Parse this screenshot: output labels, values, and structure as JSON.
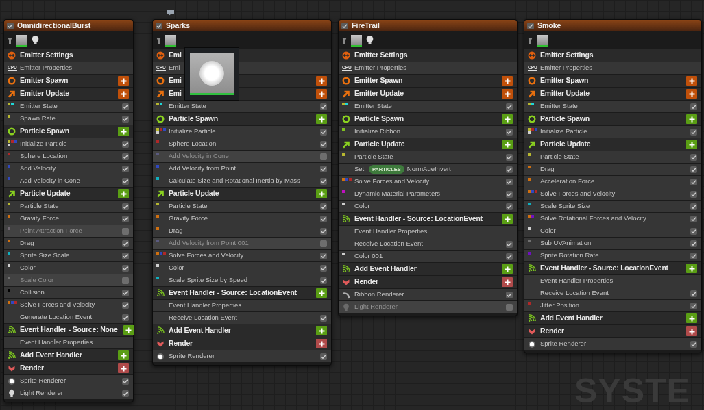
{
  "emitters": [
    {
      "name": "OmnidirectionalBurst",
      "enabled": true,
      "has_light": true,
      "preview_open": false,
      "items": [
        {
          "kind": "settings",
          "label": "Emitter Settings"
        },
        {
          "kind": "properties",
          "badge": "CPU",
          "label": "Emitter Properties"
        },
        {
          "kind": "emitter_spawn",
          "label": "Emitter Spawn"
        },
        {
          "kind": "emitter_update",
          "label": "Emitter Update"
        },
        {
          "kind": "module",
          "label": "Emitter State",
          "enabled": true,
          "dots": [
            {
              "color": "#b8b830"
            },
            {
              "color": "#20d8d8"
            }
          ]
        },
        {
          "kind": "module",
          "label": "Spawn Rate",
          "enabled": true,
          "dots": [
            {
              "color": "#b8b830"
            }
          ]
        },
        {
          "kind": "particle_spawn",
          "label": "Particle Spawn"
        },
        {
          "kind": "module",
          "label": "Initialize Particle",
          "enabled": true,
          "dots": [
            {
              "color": "#b8b830"
            },
            {
              "color": "#b02828"
            },
            {
              "color": "#3048c0"
            },
            {
              "color": "#d0d0d0"
            }
          ]
        },
        {
          "kind": "module",
          "label": "Sphere Location",
          "enabled": true,
          "dots": [
            {
              "color": "#b02828"
            }
          ]
        },
        {
          "kind": "module",
          "label": "Add Velocity",
          "enabled": true,
          "dots": [
            {
              "color": "#3048c0"
            }
          ]
        },
        {
          "kind": "module",
          "label": "Add Velocity in Cone",
          "enabled": true,
          "dots": [
            {
              "color": "#3048c0"
            }
          ]
        },
        {
          "kind": "particle_update",
          "label": "Particle Update"
        },
        {
          "kind": "module",
          "label": "Particle State",
          "enabled": true,
          "dots": [
            {
              "color": "#b8b830"
            }
          ]
        },
        {
          "kind": "module",
          "label": "Gravity Force",
          "enabled": true,
          "dots": [
            {
              "color": "#d07010"
            }
          ]
        },
        {
          "kind": "module",
          "label": "Point Attraction Force",
          "enabled": false,
          "dots": [
            {
              "color": "#6e6670"
            }
          ]
        },
        {
          "kind": "module",
          "label": "Drag",
          "enabled": true,
          "dots": [
            {
              "color": "#d07010"
            }
          ]
        },
        {
          "kind": "module",
          "label": "Sprite Size Scale",
          "enabled": true,
          "dots": [
            {
              "color": "#10b0c0"
            }
          ]
        },
        {
          "kind": "module",
          "label": "Color",
          "enabled": true,
          "dots": [
            {
              "color": "#d0d0d0"
            }
          ]
        },
        {
          "kind": "module",
          "label": "Scale Color",
          "enabled": false,
          "dots": [
            {
              "color": "#707070"
            }
          ]
        },
        {
          "kind": "module",
          "label": "Collision",
          "enabled": true,
          "dots": [
            {
              "color": "#000000"
            }
          ]
        },
        {
          "kind": "module",
          "label": "Solve Forces and Velocity",
          "enabled": true,
          "dots": [
            {
              "color": "#d07010"
            },
            {
              "color": "#3048c0"
            },
            {
              "color": "#b02828"
            }
          ]
        },
        {
          "kind": "module",
          "label": "Generate Location Event",
          "enabled": true
        },
        {
          "kind": "event_handler",
          "label": "Event Handler - Source: None"
        },
        {
          "kind": "property",
          "label": "Event Handler Properties"
        },
        {
          "kind": "add_event_handler",
          "label": "Add Event Handler"
        },
        {
          "kind": "render",
          "label": "Render"
        },
        {
          "kind": "sprite_renderer",
          "label": "Sprite Renderer",
          "enabled": true
        },
        {
          "kind": "light_renderer",
          "label": "Light Renderer",
          "enabled": true
        }
      ]
    },
    {
      "name": "Sparks",
      "enabled": true,
      "has_light": false,
      "preview_open": true,
      "items": [
        {
          "kind": "settings",
          "label": "Emi"
        },
        {
          "kind": "properties",
          "badge": "CPU",
          "label": "Emi"
        },
        {
          "kind": "emitter_spawn",
          "label": "Emi"
        },
        {
          "kind": "emitter_update",
          "label": "Emi"
        },
        {
          "kind": "module",
          "label": "Emitter State",
          "enabled": true,
          "dots": [
            {
              "color": "#b8b830"
            },
            {
              "color": "#20d8d8"
            }
          ]
        },
        {
          "kind": "particle_spawn",
          "label": "Particle Spawn"
        },
        {
          "kind": "module",
          "label": "Initialize Particle",
          "enabled": true,
          "dots": [
            {
              "color": "#b8b830"
            },
            {
              "color": "#b02828"
            },
            {
              "color": "#3048c0"
            },
            {
              "color": "#d0d0d0"
            }
          ]
        },
        {
          "kind": "module",
          "label": "Sphere Location",
          "enabled": true,
          "dots": [
            {
              "color": "#b02828"
            }
          ]
        },
        {
          "kind": "module",
          "label": "Add Velocity in Cone",
          "enabled": false,
          "dots": [
            {
              "color": "#5a5a80"
            }
          ]
        },
        {
          "kind": "module",
          "label": "Add Velocity from Point",
          "enabled": true,
          "dots": [
            {
              "color": "#3048c0"
            }
          ]
        },
        {
          "kind": "module",
          "label": "Calculate Size and Rotational Inertia by Mass",
          "enabled": true,
          "dots": [
            {
              "color": "#10b0c0"
            }
          ]
        },
        {
          "kind": "particle_update",
          "label": "Particle Update"
        },
        {
          "kind": "module",
          "label": "Particle State",
          "enabled": true,
          "dots": [
            {
              "color": "#b8b830"
            }
          ]
        },
        {
          "kind": "module",
          "label": "Gravity Force",
          "enabled": true,
          "dots": [
            {
              "color": "#d07010"
            }
          ]
        },
        {
          "kind": "module",
          "label": "Drag",
          "enabled": true,
          "dots": [
            {
              "color": "#d07010"
            }
          ]
        },
        {
          "kind": "module",
          "label": "Add Velocity from Point 001",
          "enabled": false,
          "dots": [
            {
              "color": "#5a5a80"
            }
          ]
        },
        {
          "kind": "module",
          "label": "Solve Forces and Velocity",
          "enabled": true,
          "dots": [
            {
              "color": "#d07010"
            },
            {
              "color": "#3048c0"
            },
            {
              "color": "#b02828"
            }
          ]
        },
        {
          "kind": "module",
          "label": "Color",
          "enabled": true,
          "dots": [
            {
              "color": "#d0d0d0"
            }
          ]
        },
        {
          "kind": "module",
          "label": "Scale Sprite Size by Speed",
          "enabled": true,
          "dots": [
            {
              "color": "#10b0c0"
            }
          ]
        },
        {
          "kind": "event_handler",
          "label": "Event Handler - Source: LocationEvent"
        },
        {
          "kind": "property",
          "label": "Event Handler Properties"
        },
        {
          "kind": "module",
          "label": "Receive Location Event",
          "enabled": true
        },
        {
          "kind": "add_event_handler",
          "label": "Add Event Handler"
        },
        {
          "kind": "render",
          "label": "Render"
        },
        {
          "kind": "sprite_renderer",
          "label": "Sprite Renderer",
          "enabled": true
        }
      ]
    },
    {
      "name": "FireTrail",
      "enabled": true,
      "has_light": true,
      "preview_open": false,
      "items": [
        {
          "kind": "settings",
          "label": "Emitter Settings"
        },
        {
          "kind": "properties",
          "badge": "CPU",
          "label": "Emitter Properties"
        },
        {
          "kind": "emitter_spawn",
          "label": "Emitter Spawn"
        },
        {
          "kind": "emitter_update",
          "label": "Emitter Update"
        },
        {
          "kind": "module",
          "label": "Emitter State",
          "enabled": true,
          "dots": [
            {
              "color": "#b8b830"
            },
            {
              "color": "#20d8d8"
            }
          ]
        },
        {
          "kind": "particle_spawn",
          "label": "Particle Spawn"
        },
        {
          "kind": "module",
          "label": "Initialize Ribbon",
          "enabled": true,
          "dots": [
            {
              "color": "#80c020"
            }
          ]
        },
        {
          "kind": "particle_update",
          "label": "Particle Update"
        },
        {
          "kind": "module",
          "label": "Particle State",
          "enabled": true,
          "dots": [
            {
              "color": "#b8b830"
            }
          ]
        },
        {
          "kind": "set",
          "label": "Set:",
          "tag": "PARTICLES",
          "target": "NormAgeInvert",
          "enabled": true
        },
        {
          "kind": "module",
          "label": "Solve Forces and Velocity",
          "enabled": true,
          "dots": [
            {
              "color": "#d07010"
            },
            {
              "color": "#3048c0"
            },
            {
              "color": "#b02828"
            }
          ]
        },
        {
          "kind": "module",
          "label": "Dynamic Material Parameters",
          "enabled": true,
          "dots": [
            {
              "color": "#c010c0"
            }
          ]
        },
        {
          "kind": "module",
          "label": "Color",
          "enabled": true,
          "dots": [
            {
              "color": "#d0d0d0"
            }
          ]
        },
        {
          "kind": "event_handler",
          "label": "Event Handler - Source: LocationEvent"
        },
        {
          "kind": "property",
          "label": "Event Handler Properties"
        },
        {
          "kind": "module",
          "label": "Receive Location Event",
          "enabled": true
        },
        {
          "kind": "module",
          "label": "Color 001",
          "enabled": true,
          "dots": [
            {
              "color": "#d0d0d0"
            }
          ]
        },
        {
          "kind": "add_event_handler",
          "label": "Add Event Handler"
        },
        {
          "kind": "render",
          "label": "Render"
        },
        {
          "kind": "ribbon_renderer",
          "label": "Ribbon Renderer",
          "enabled": true
        },
        {
          "kind": "light_renderer",
          "label": "Light Renderer",
          "enabled": false
        }
      ]
    },
    {
      "name": "Smoke",
      "enabled": true,
      "has_light": false,
      "preview_open": false,
      "items": [
        {
          "kind": "settings",
          "label": "Emitter Settings"
        },
        {
          "kind": "properties",
          "badge": "CPU",
          "label": "Emitter Properties"
        },
        {
          "kind": "emitter_spawn",
          "label": "Emitter Spawn"
        },
        {
          "kind": "emitter_update",
          "label": "Emitter Update"
        },
        {
          "kind": "module",
          "label": "Emitter State",
          "enabled": true,
          "dots": [
            {
              "color": "#b8b830"
            },
            {
              "color": "#20d8d8"
            }
          ]
        },
        {
          "kind": "particle_spawn",
          "label": "Particle Spawn"
        },
        {
          "kind": "module",
          "label": "Initialize Particle",
          "enabled": true,
          "dots": [
            {
              "color": "#b8b830"
            },
            {
              "color": "#b02828"
            },
            {
              "color": "#3048c0"
            },
            {
              "color": "#d0d0d0"
            }
          ]
        },
        {
          "kind": "particle_update",
          "label": "Particle Update"
        },
        {
          "kind": "module",
          "label": "Particle State",
          "enabled": true,
          "dots": [
            {
              "color": "#b8b830"
            }
          ]
        },
        {
          "kind": "module",
          "label": "Drag",
          "enabled": true,
          "dots": [
            {
              "color": "#d07010"
            }
          ]
        },
        {
          "kind": "module",
          "label": "Acceleration Force",
          "enabled": true,
          "dots": [
            {
              "color": "#d07010"
            }
          ]
        },
        {
          "kind": "module",
          "label": "Solve Forces and Velocity",
          "enabled": true,
          "dots": [
            {
              "color": "#d07010"
            },
            {
              "color": "#3048c0"
            },
            {
              "color": "#b02828"
            }
          ]
        },
        {
          "kind": "module",
          "label": "Scale Sprite Size",
          "enabled": true,
          "dots": [
            {
              "color": "#10b0c0"
            }
          ]
        },
        {
          "kind": "module",
          "label": "Solve Rotational Forces and Velocity",
          "enabled": true,
          "dots": [
            {
              "color": "#d07010"
            },
            {
              "color": "#7010c0"
            }
          ]
        },
        {
          "kind": "module",
          "label": "Color",
          "enabled": true,
          "dots": [
            {
              "color": "#d0d0d0"
            }
          ]
        },
        {
          "kind": "module",
          "label": "Sub UVAnimation",
          "enabled": true,
          "dots": [
            {
              "color": "#707070"
            }
          ]
        },
        {
          "kind": "module",
          "label": "Sprite Rotation Rate",
          "enabled": true,
          "dots": [
            {
              "color": "#7010c0"
            }
          ]
        },
        {
          "kind": "event_handler",
          "label": "Event Handler - Source: LocationEvent"
        },
        {
          "kind": "property",
          "label": "Event Handler Properties"
        },
        {
          "kind": "module",
          "label": "Receive Location Event",
          "enabled": true
        },
        {
          "kind": "module",
          "label": "Jitter Position",
          "enabled": true,
          "dots": [
            {
              "color": "#b02828"
            }
          ]
        },
        {
          "kind": "add_event_handler",
          "label": "Add Event Handler"
        },
        {
          "kind": "render",
          "label": "Render"
        },
        {
          "kind": "sprite_renderer",
          "label": "Sprite Renderer",
          "enabled": true
        }
      ]
    }
  ],
  "graph_watermark": "SYSTE"
}
